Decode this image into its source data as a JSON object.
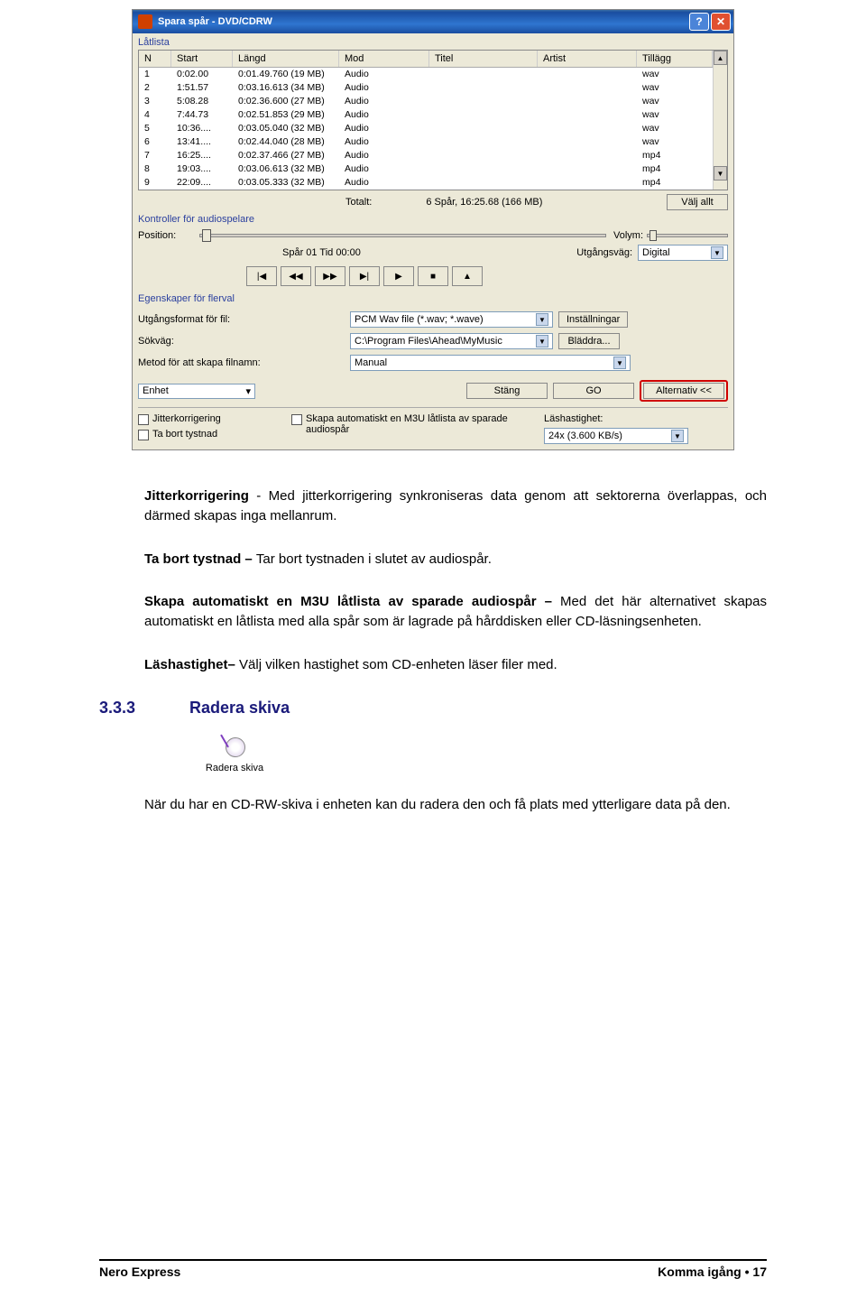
{
  "window": {
    "title": "Spara spår  -  DVD/CDRW",
    "panels": {
      "latlista": "Låtlista",
      "kontroller": "Kontroller för audiospelare",
      "egenskaper": "Egenskaper för flerval"
    },
    "columns": {
      "n": "N",
      "start": "Start",
      "langd": "Längd",
      "mod": "Mod",
      "titel": "Titel",
      "artist": "Artist",
      "tillagg": "Tillägg"
    },
    "tracks": [
      {
        "n": "1",
        "start": "0:02.00",
        "langd": "0:01.49.760 (19 MB)",
        "mod": "Audio",
        "tillagg": "wav"
      },
      {
        "n": "2",
        "start": "1:51.57",
        "langd": "0:03.16.613 (34 MB)",
        "mod": "Audio",
        "tillagg": "wav"
      },
      {
        "n": "3",
        "start": "5:08.28",
        "langd": "0:02.36.600 (27 MB)",
        "mod": "Audio",
        "tillagg": "wav"
      },
      {
        "n": "4",
        "start": "7:44.73",
        "langd": "0:02.51.853 (29 MB)",
        "mod": "Audio",
        "tillagg": "wav"
      },
      {
        "n": "5",
        "start": "10:36....",
        "langd": "0:03.05.040 (32 MB)",
        "mod": "Audio",
        "tillagg": "wav"
      },
      {
        "n": "6",
        "start": "13:41....",
        "langd": "0:02.44.040 (28 MB)",
        "mod": "Audio",
        "tillagg": "wav"
      },
      {
        "n": "7",
        "start": "16:25....",
        "langd": "0:02.37.466 (27 MB)",
        "mod": "Audio",
        "tillagg": "mp4"
      },
      {
        "n": "8",
        "start": "19:03....",
        "langd": "0:03.06.613 (32 MB)",
        "mod": "Audio",
        "tillagg": "mp4"
      },
      {
        "n": "9",
        "start": "22:09....",
        "langd": "0:03.05.333 (32 MB)",
        "mod": "Audio",
        "tillagg": "mp4"
      }
    ],
    "totals": {
      "label": "Totalt:",
      "value": "6 Spår,   16:25.68 (166 MB)"
    },
    "valj_allt": "Välj allt",
    "player": {
      "position_label": "Position:",
      "track_label": "Spår 01 Tid 00:00",
      "volym_label": "Volym:",
      "utgang_label": "Utgångsväg:",
      "utgang_value": "Digital"
    },
    "props": {
      "utgangsformat_label": "Utgångsformat för fil:",
      "utgangsformat_val": "PCM Wav file (*.wav; *.wave)",
      "installningar": "Inställningar",
      "sokvag_label": "Sökväg:",
      "sokvag_val": "C:\\Program Files\\Ahead\\MyMusic",
      "bladdra": "Bläddra...",
      "metod_label": "Metod för att skapa filnamn:",
      "metod_val": "Manual"
    },
    "enhet": "Enhet",
    "buttons": {
      "stang": "Stäng",
      "go": "GO",
      "alternativ": "Alternativ <<"
    },
    "checks": {
      "jitter": "Jitterkorrigering",
      "tabort": "Ta bort tystnad",
      "m3u": "Skapa automatiskt en M3U låtlista av sparade audiospår",
      "lashastighet_label": "Läshastighet:",
      "lashastighet_val": "24x (3.600 KB/s)"
    }
  },
  "body": {
    "p1_bold": "Jitterkorrigering",
    "p1_rest": " - Med jitterkorrigering synkroniseras data genom att sektorerna överlappas, och därmed skapas inga mellanrum.",
    "p2_bold": "Ta bort tystnad – ",
    "p2_rest": "Tar bort tystnaden i slutet av audiospår.",
    "p3_bold": "Skapa automatiskt en M3U låtlista av sparade audiospår – ",
    "p3_rest": "Med det här alternativet skapas automatiskt en låtlista med alla spår som är lagrade på hårddisken eller CD-läsningsenheten.",
    "p4_bold": "Läshastighet– ",
    "p4_rest": "Välj vilken hastighet som CD-enheten läser filer med.",
    "section_num": "3.3.3",
    "section_title": "Radera skiva",
    "radera_label": "Radera skiva",
    "p5": "När du har en CD-RW-skiva i enheten kan du radera den och få plats med ytterligare data på den."
  },
  "footer": {
    "left": "Nero Express",
    "right": "Komma igång • 17"
  }
}
